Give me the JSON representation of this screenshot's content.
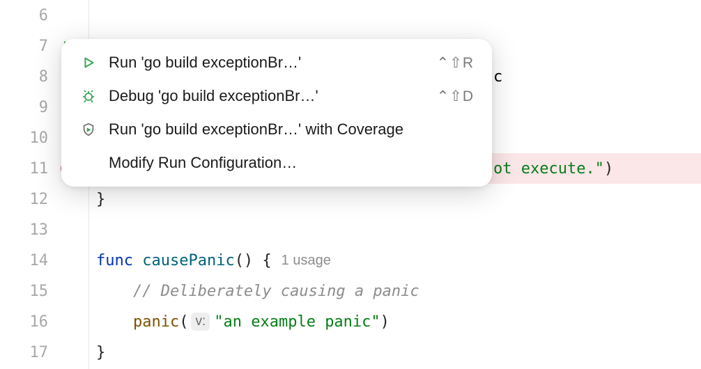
{
  "gutter": {
    "lines": [
      "6",
      "7",
      "8",
      "9",
      "10",
      "11",
      "12",
      "13",
      "14",
      "15",
      "16",
      "17"
    ],
    "run_icon_line_index": 1,
    "breakpoint_line_index": 5
  },
  "popup": {
    "items": [
      {
        "icon": "play-icon",
        "label": "Run 'go build exceptionBr…'",
        "shortcut": "⌃⇧R"
      },
      {
        "icon": "bug-icon",
        "label": "Debug 'go build exceptionBr…'",
        "shortcut": "⌃⇧D"
      },
      {
        "icon": "shield-play-icon",
        "label": "Run 'go build exceptionBr…' with Coverage",
        "shortcut": ""
      },
      {
        "icon": "",
        "label": "Modify Run Configuration…",
        "shortcut": ""
      }
    ]
  },
  "code": {
    "line8_tail": "c",
    "line11_str_tail": "ot execute.\"",
    "line11_paren": ")",
    "line12_brace": "}",
    "line14_func": "func",
    "line14_name": "causePanic",
    "line14_sig": "() {",
    "line14_hint": "1 usage",
    "line15_comment": "// Deliberately causing a panic",
    "line16_call": "panic",
    "line16_paren_open": "(",
    "line16_param_hint": "v:",
    "line16_str": "\"an example panic\"",
    "line16_paren_close": ")",
    "line17_brace": "}"
  }
}
